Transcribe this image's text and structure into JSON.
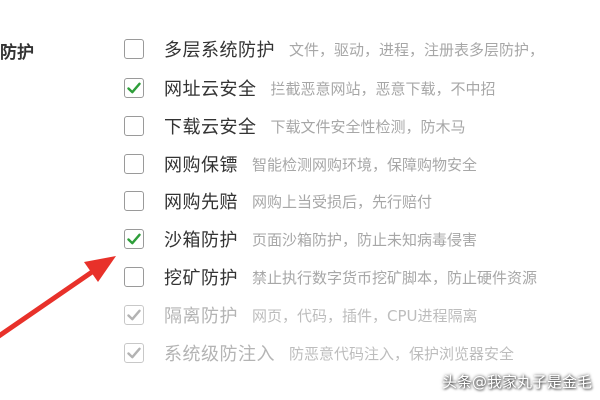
{
  "section": {
    "title_partial": "防护"
  },
  "options": [
    {
      "name": "多层系统防护",
      "description": "文件，驱动，进程，注册表多层防护，",
      "checked": false,
      "disabled": false
    },
    {
      "name": "网址云安全",
      "description": "拦截恶意网站，恶意下载，不中招",
      "checked": true,
      "disabled": false
    },
    {
      "name": "下载云安全",
      "description": "下载文件安全性检测，防木马",
      "checked": false,
      "disabled": false
    },
    {
      "name": "网购保镖",
      "description": "智能检测网购环境，保障购物安全",
      "checked": false,
      "disabled": false
    },
    {
      "name": "网购先赔",
      "description": "网购上当受损后，先行赔付",
      "checked": false,
      "disabled": false
    },
    {
      "name": "沙箱防护",
      "description": "页面沙箱防护，防止未知病毒侵害",
      "checked": true,
      "disabled": false
    },
    {
      "name": "挖矿防护",
      "description": "禁止执行数字货币挖矿脚本，防止硬件资源",
      "checked": false,
      "disabled": false
    },
    {
      "name": "隔离防护",
      "description": "网页，代码，插件，CPU进程隔离",
      "checked": true,
      "disabled": true
    },
    {
      "name": "系统级防注入",
      "description": "防恶意代码注入，保护浏览器安全",
      "checked": true,
      "disabled": true
    }
  ],
  "watermark": {
    "text": "头条@我家丸子是金毛"
  },
  "colors": {
    "check_active": "#2e9e3a",
    "check_disabled": "#b3b3b3",
    "arrow": "#e8312a",
    "text_primary": "#333333",
    "text_secondary": "#a7a7a7",
    "text_disabled": "#b4b4b4"
  }
}
